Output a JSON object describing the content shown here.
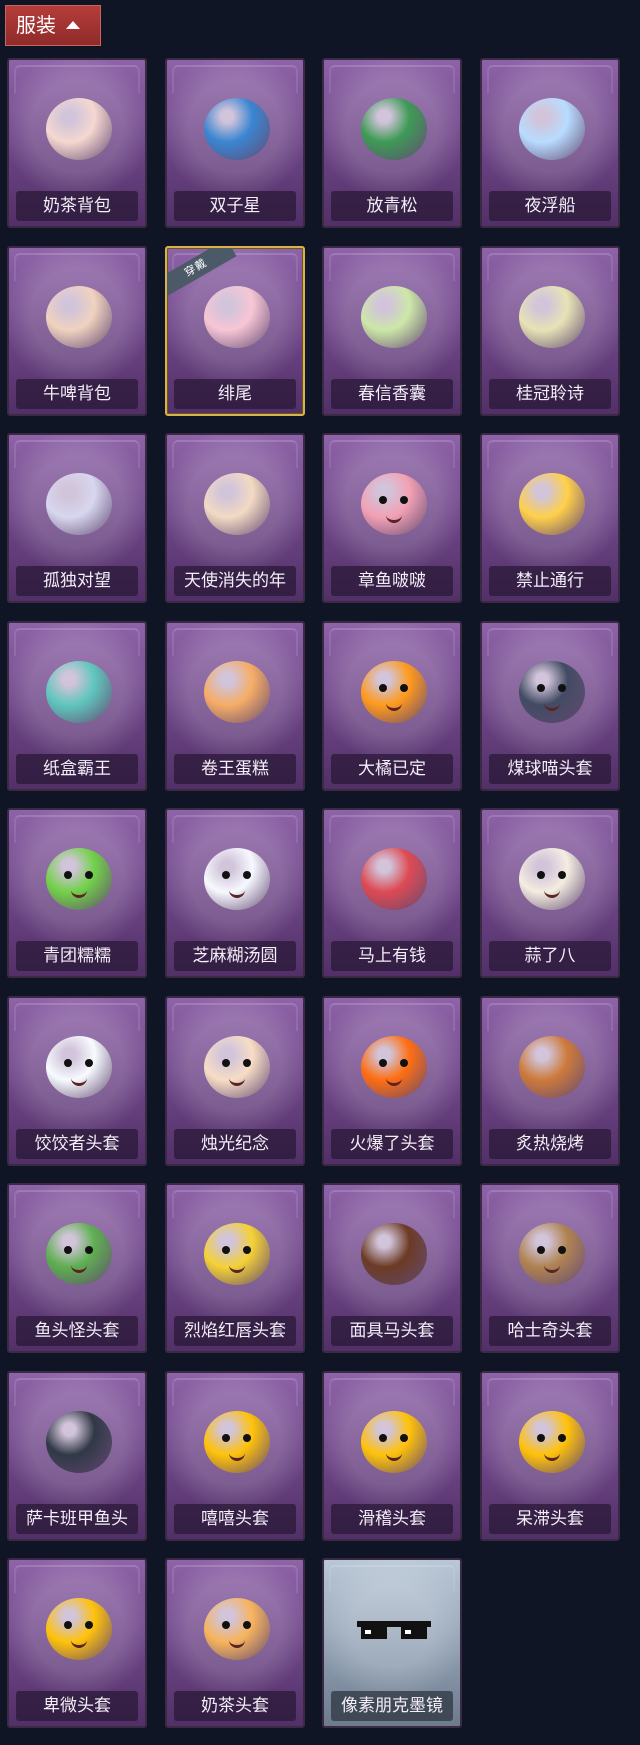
{
  "header": {
    "title": "服装"
  },
  "items": [
    {
      "name": "奶茶背包",
      "worn": false,
      "icon": "milk-tea-backpack-icon",
      "color": "#f5d8d0"
    },
    {
      "name": "双子星",
      "worn": false,
      "icon": "twin-stars-icon",
      "color": "#3a85d1"
    },
    {
      "name": "放青松",
      "worn": false,
      "icon": "pine-bonsai-icon",
      "color": "#3e9a56"
    },
    {
      "name": "夜浮船",
      "worn": false,
      "icon": "jellyfish-icon",
      "color": "#b8dcff"
    },
    {
      "name": "牛啤背包",
      "worn": false,
      "icon": "cow-barrel-icon",
      "color": "#f0d2bf"
    },
    {
      "name": "绯尾",
      "worn": true,
      "badge": "穿戴",
      "icon": "fox-girl-charm-icon",
      "color": "#f7c6d5"
    },
    {
      "name": "春信香囊",
      "worn": false,
      "icon": "sachet-icon",
      "color": "#cde7a9"
    },
    {
      "name": "桂冠聆诗",
      "worn": false,
      "icon": "laurel-fairy-icon",
      "color": "#e7e3b5"
    },
    {
      "name": "孤独对望",
      "worn": false,
      "icon": "lonely-gaze-charm-icon",
      "color": "#d7d7ef"
    },
    {
      "name": "天使消失的年",
      "worn": false,
      "icon": "angel-charm-icon",
      "color": "#f2dac3"
    },
    {
      "name": "章鱼啵啵",
      "worn": false,
      "icon": "octopus-icon",
      "color": "#f3a1b4"
    },
    {
      "name": "禁止通行",
      "worn": false,
      "icon": "traffic-cone-icon",
      "color": "#ffd04a"
    },
    {
      "name": "纸盒霸王",
      "worn": false,
      "icon": "box-dino-icon",
      "color": "#5fc6bd"
    },
    {
      "name": "卷王蛋糕",
      "worn": false,
      "icon": "roll-cake-icon",
      "color": "#f6ad66"
    },
    {
      "name": "大橘已定",
      "worn": false,
      "icon": "orange-face-icon",
      "color": "#ff9a1d"
    },
    {
      "name": "煤球喵头套",
      "worn": false,
      "icon": "black-cat-head-icon",
      "color": "#424b63"
    },
    {
      "name": "青团糯糯",
      "worn": false,
      "icon": "green-rice-ball-icon",
      "color": "#72d149"
    },
    {
      "name": "芝麻糊汤圆",
      "worn": false,
      "icon": "rice-dumpling-icon",
      "color": "#f7f9ff"
    },
    {
      "name": "马上有钱",
      "worn": false,
      "icon": "red-horse-icon",
      "color": "#dd4a53"
    },
    {
      "name": "蒜了八",
      "worn": false,
      "icon": "garlic-icon",
      "color": "#f4ede1"
    },
    {
      "name": "饺饺者头套",
      "worn": false,
      "icon": "dumpling-head-icon",
      "color": "#f7fbff"
    },
    {
      "name": "烛光纪念",
      "worn": false,
      "icon": "candle-icon",
      "color": "#f8ddc5"
    },
    {
      "name": "火爆了头套",
      "worn": false,
      "icon": "fire-head-icon",
      "color": "#ff6e12"
    },
    {
      "name": "炙热烧烤",
      "worn": false,
      "icon": "grilled-meat-icon",
      "color": "#cd7a3b"
    },
    {
      "name": "鱼头怪头套",
      "worn": false,
      "icon": "fish-head-icon",
      "color": "#5eaf50"
    },
    {
      "name": "烈焰红唇头套",
      "worn": false,
      "icon": "pikachu-head-icon",
      "color": "#f4d135"
    },
    {
      "name": "面具马头套",
      "worn": false,
      "icon": "horse-mask-icon",
      "color": "#6c3b24"
    },
    {
      "name": "哈士奇头套",
      "worn": false,
      "icon": "husky-head-icon",
      "color": "#b08352"
    },
    {
      "name": "萨卡班甲鱼头",
      "worn": false,
      "icon": "sacabambaspis-icon",
      "color": "#303846"
    },
    {
      "name": "嘻嘻头套",
      "worn": false,
      "icon": "grinning-emoji-icon",
      "color": "#ffc20a"
    },
    {
      "name": "滑稽头套",
      "worn": false,
      "icon": "funny-emoji-icon",
      "color": "#ffc20a"
    },
    {
      "name": "呆滞头套",
      "worn": false,
      "icon": "stunned-emoji-icon",
      "color": "#ffc20a"
    },
    {
      "name": "卑微头套",
      "worn": false,
      "icon": "humble-emoji-icon",
      "color": "#ffc20a"
    },
    {
      "name": "奶茶头套",
      "worn": false,
      "icon": "milk-tea-head-icon",
      "color": "#f7b45d"
    },
    {
      "name": "像素朋克墨镜",
      "worn": false,
      "icon": "pixel-sunglasses-icon",
      "color": "#111111",
      "special": true
    }
  ]
}
